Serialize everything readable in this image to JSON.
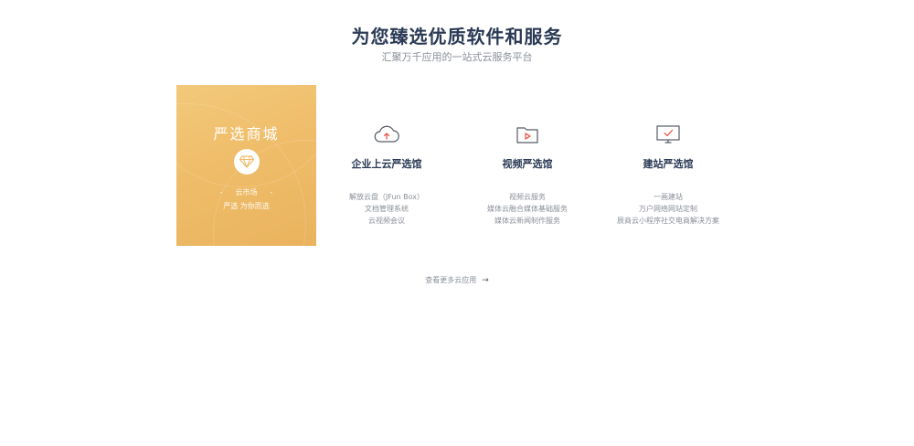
{
  "header": {
    "title": "为您臻选优质软件和服务",
    "subtitle": "汇聚万千应用的一站式云服务平台"
  },
  "promo": {
    "title": "严选商城",
    "icon": "diamond-icon",
    "market_label": "云市场",
    "slogan": "严选 为你而选"
  },
  "services": [
    {
      "icon": "cloud-upload-icon",
      "title": "企业上云严选馆",
      "items": [
        "解放云盘（JFun Box）",
        "文档管理系统",
        "云视频会议"
      ]
    },
    {
      "icon": "video-folder-icon",
      "title": "视频严选馆",
      "items": [
        "视频云服务",
        "媒体云融合媒体基础服务",
        "媒体云新闻制作服务"
      ]
    },
    {
      "icon": "monitor-check-icon",
      "title": "建站严选馆",
      "items": [
        "一画建站",
        "万户网络网站定制",
        "辰商云小程序社交电商解决方案"
      ]
    }
  ],
  "more": {
    "label": "查看更多云应用",
    "icon": "arrow-right-icon"
  },
  "colors": {
    "accent": "#e8473b",
    "promo_gold": "#efbd6a",
    "heading": "#2b3a55",
    "muted": "#8a8f99"
  }
}
